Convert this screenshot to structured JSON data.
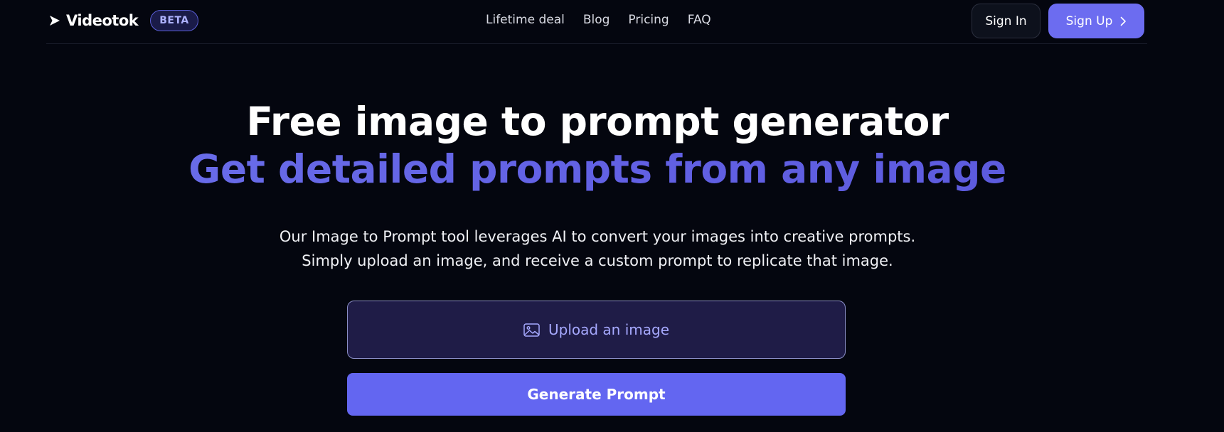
{
  "header": {
    "logo_text": "Videotok",
    "badge": "BETA",
    "nav": [
      {
        "label": "Lifetime deal"
      },
      {
        "label": "Blog"
      },
      {
        "label": "Pricing"
      },
      {
        "label": "FAQ"
      }
    ],
    "sign_in": "Sign In",
    "sign_up": "Sign Up"
  },
  "hero": {
    "title": "Free image to prompt generator",
    "subtitle": "Get detailed prompts from any image",
    "description_line1": "Our Image to Prompt tool leverages AI to convert your images into creative prompts.",
    "description_line2": "Simply upload an image, and receive a custom prompt to replicate that image."
  },
  "upload": {
    "label": "Upload an image",
    "icon": "image-icon"
  },
  "generate": {
    "label": "Generate Prompt"
  },
  "colors": {
    "background": "#04060f",
    "accent": "#6366f1",
    "upload_bg": "#1f1c47",
    "badge_bg": "#1a1b48"
  }
}
